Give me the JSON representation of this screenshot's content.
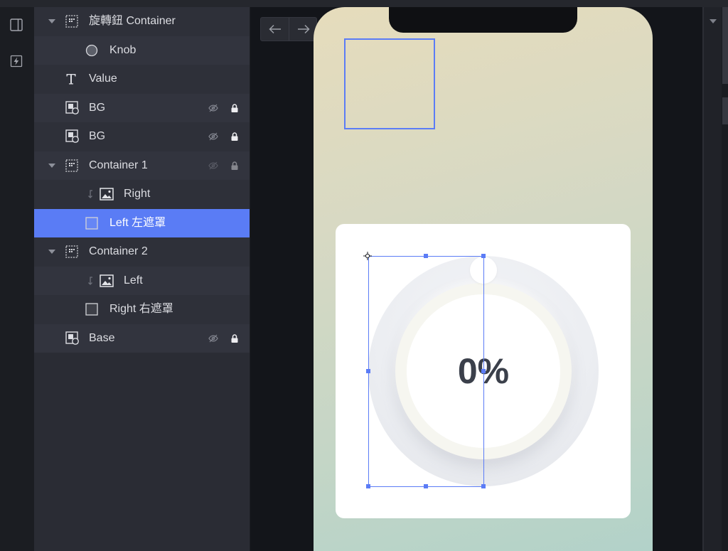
{
  "app": {
    "accent_color": "#5b7cf6",
    "selected_row_color": "#5a7cf5"
  },
  "toolbar": {
    "items": [
      {
        "icon": "panel-toggle-icon"
      },
      {
        "icon": "interaction-icon"
      }
    ]
  },
  "layers": [
    {
      "label": "旋轉鈕 Container",
      "icon": "container-icon",
      "depth": 0,
      "expand_icon": "chevron-down-icon"
    },
    {
      "label": "Knob",
      "icon": "ellipse-icon",
      "depth": 1
    },
    {
      "label": "Value",
      "icon": "text-icon",
      "depth": 0
    },
    {
      "label": "BG",
      "icon": "shape-image-icon",
      "depth": 0,
      "status_icons": [
        "eye-slash-icon",
        "lock-icon"
      ]
    },
    {
      "label": "BG",
      "icon": "shape-image-icon",
      "depth": 0,
      "status_icons": [
        "eye-slash-icon",
        "lock-icon"
      ]
    },
    {
      "label": "Container 1",
      "icon": "container-icon",
      "depth": 0,
      "expand_icon": "chevron-down-icon",
      "status_icons": [
        "eye-slash-icon",
        "lock-icon"
      ],
      "status_dimmed": true
    },
    {
      "label": "Right",
      "icon": "image-icon",
      "depth": 1,
      "mask_icon": "mask-arrow-icon"
    },
    {
      "label": "Left 左遮罩",
      "icon": "rectangle-icon",
      "depth": 1,
      "selected": true
    },
    {
      "label": "Container 2",
      "icon": "container-icon",
      "depth": 0,
      "expand_icon": "chevron-down-icon"
    },
    {
      "label": "Left",
      "icon": "image-icon",
      "depth": 1,
      "mask_icon": "mask-arrow-icon"
    },
    {
      "label": "Right 右遮罩",
      "icon": "rectangle-icon",
      "depth": 1
    },
    {
      "label": "Base",
      "icon": "shape-image-icon",
      "depth": 0,
      "status_icons": [
        "eye-slash-icon",
        "lock-icon"
      ]
    }
  ],
  "canvas": {
    "nav": {
      "back_icon": "arrow-left-icon",
      "forward_icon": "arrow-right-icon"
    },
    "phone": {
      "background_gradient": [
        "#e6dcbc",
        "#d8d9c3",
        "#c5d6c6",
        "#b2d2c9"
      ]
    },
    "knob_widget": {
      "value_text": "0%",
      "text_color": "#3b404b"
    },
    "selection": {
      "pivot_icon": "pivot-crosshair-icon"
    }
  },
  "right_panel": {
    "icon": "dropdown-triangle-icon"
  }
}
